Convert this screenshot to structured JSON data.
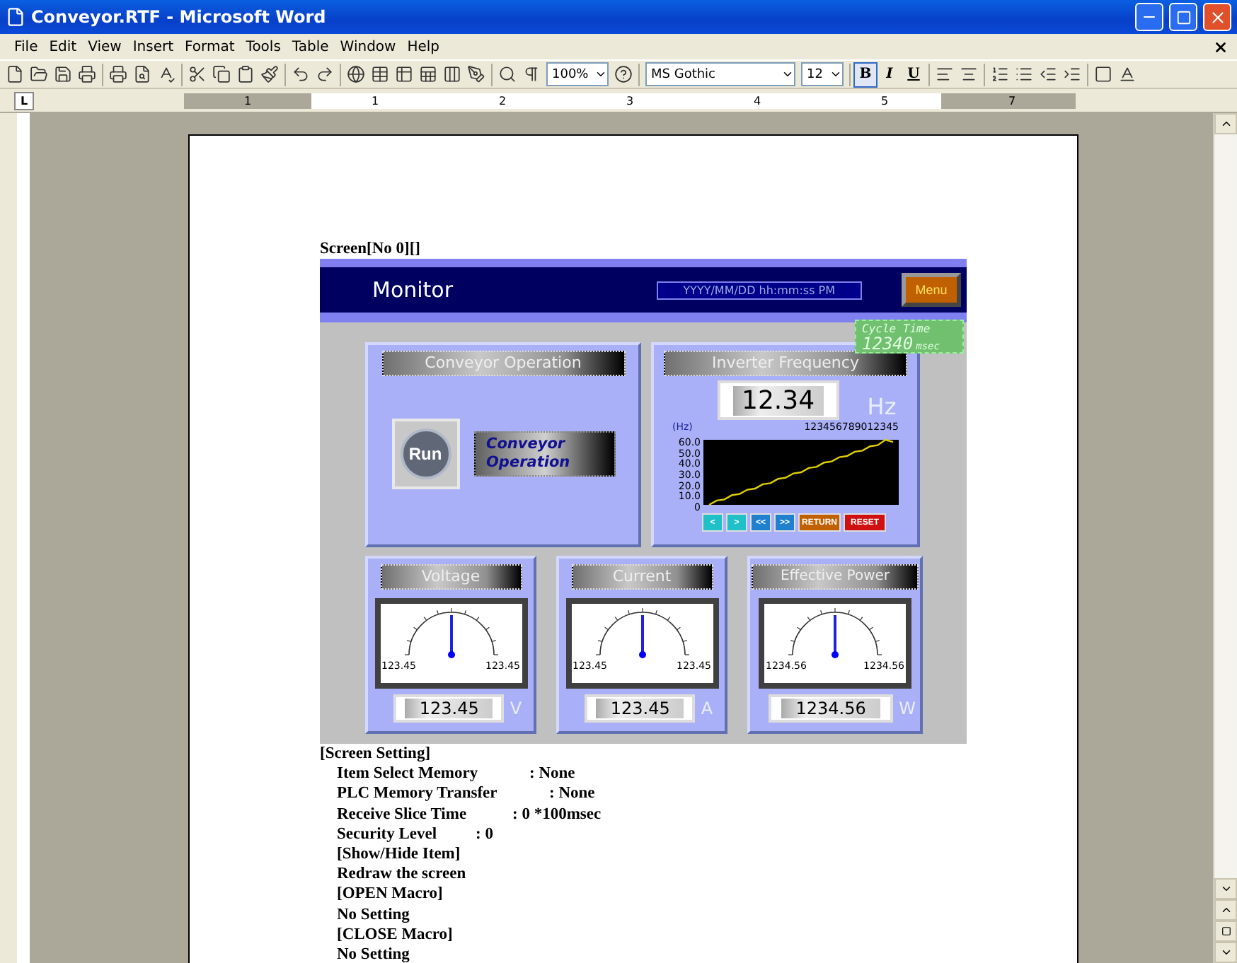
{
  "window": {
    "title": "Conveyor.RTF - Microsoft Word"
  },
  "menu": [
    "File",
    "Edit",
    "View",
    "Insert",
    "Format",
    "Tools",
    "Table",
    "Window",
    "Help"
  ],
  "toolbar": {
    "zoom": "100%",
    "font": "MS Gothic",
    "size": "12",
    "format_buttons": [
      {
        "label": "B",
        "pressed": true
      },
      {
        "label": "I",
        "pressed": false
      },
      {
        "label": "U",
        "pressed": false
      }
    ]
  },
  "tab_selector": "L",
  "ruler": [
    "1",
    "1",
    "2",
    "3",
    "4",
    "5",
    "7"
  ],
  "document": {
    "caption": "Screen[No 0][]",
    "monitor": {
      "title": "Monitor",
      "datetime": "YYYY/MM/DD hh:mm:ss PM",
      "menu_button": "Menu",
      "cycle_time": {
        "label": "Cycle Time",
        "value": "12340",
        "unit": "msec"
      },
      "conveyor": {
        "title": "Conveyor Operation",
        "button": "Run",
        "lamp": "Conveyor Operation"
      },
      "inverter": {
        "title": "Inverter Frequency",
        "value": "12.34",
        "unit": "Hz",
        "trend_unit": "(Hz)",
        "counter": "123456789012345",
        "chart_data": {
          "type": "line",
          "ylim": [
            0,
            60
          ],
          "yticks": [
            {
              "value": 60,
              "label": "60.0"
            },
            {
              "value": 50,
              "label": "50.0"
            },
            {
              "value": 40,
              "label": "40.0"
            },
            {
              "value": 30,
              "label": "30.0"
            },
            {
              "value": 20,
              "label": "20.0"
            },
            {
              "value": 10,
              "label": "10.0"
            },
            {
              "value": 0,
              "label": "0"
            }
          ],
          "series": [
            {
              "color": "#e0d000",
              "values": [
                0,
                4,
                5,
                9,
                10,
                14,
                15,
                19,
                20,
                24,
                25,
                29,
                30,
                34,
                35,
                39,
                40,
                44,
                45,
                49,
                50,
                54,
                55,
                60,
                58
              ]
            }
          ]
        },
        "buttons": [
          {
            "label": "<",
            "kind": "nav"
          },
          {
            "label": ">",
            "kind": "nav"
          },
          {
            "label": "<<",
            "kind": "page"
          },
          {
            "label": ">>",
            "kind": "page"
          },
          {
            "label": "RETURN",
            "kind": "return"
          },
          {
            "label": "RESET",
            "kind": "reset"
          }
        ]
      },
      "meters": [
        {
          "title": "Voltage",
          "min": "123.45",
          "max": "123.45",
          "value": "123.45",
          "unit": "V",
          "level": 0.5
        },
        {
          "title": "Current",
          "min": "123.45",
          "max": "123.45",
          "value": "123.45",
          "unit": "A",
          "level": 0.5
        },
        {
          "title": "Effective Power",
          "min": "1234.56",
          "max": "1234.56",
          "value": "1234.56",
          "unit": "W",
          "level": 0.5
        }
      ]
    },
    "settings": {
      "heading": "[Screen Setting]",
      "children": [
        {
          "label": "Item Select Memory",
          "value": ": None"
        },
        {
          "label": "PLC Memory Transfer",
          "value": ": None"
        },
        {
          "label": "Receive Slice Time",
          "value": ": 0 *100msec"
        },
        {
          "label": "Security Level",
          "value": ": 0"
        },
        {
          "label": "[Show/Hide Item]"
        },
        {
          "label": "Redraw the screen"
        },
        {
          "label": "[OPEN Macro]"
        },
        {
          "label": "No Setting"
        },
        {
          "label": "[CLOSE Macro]"
        },
        {
          "label": "No Setting"
        }
      ]
    }
  }
}
